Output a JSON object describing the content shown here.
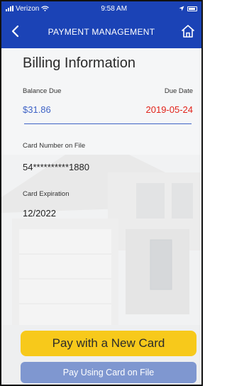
{
  "status_bar": {
    "carrier": "Verizon",
    "time": "9:58 AM"
  },
  "nav": {
    "title": "PAYMENT MANAGEMENT",
    "back_icon": "chevron-left-icon",
    "home_icon": "home-icon"
  },
  "billing": {
    "heading": "Billing Information",
    "balance_due_label": "Balance Due",
    "balance_due_value": "$31.86",
    "due_date_label": "Due Date",
    "due_date_value": "2019-05-24",
    "card_number_label": "Card Number on File",
    "card_number_value": "54**********1880",
    "card_expiration_label": "Card Expiration",
    "card_expiration_value": "12/2022"
  },
  "actions": {
    "pay_new_card_label": "Pay with a New Card",
    "pay_on_file_label": "Pay Using Card on File"
  },
  "colors": {
    "brand_blue": "#1b43b6",
    "balance_blue": "#3f63c6",
    "due_red": "#e2231a",
    "primary_button": "#f7c91b",
    "secondary_button": "#7f97d0"
  }
}
